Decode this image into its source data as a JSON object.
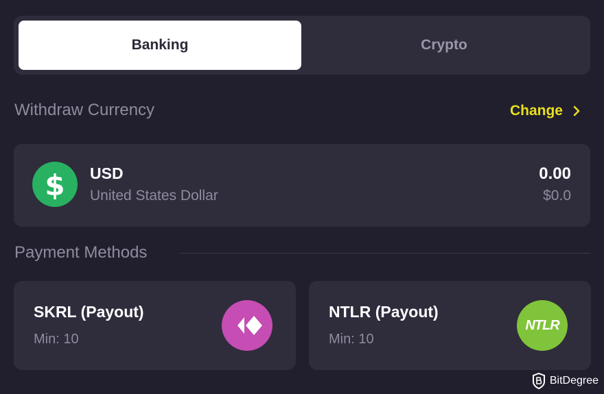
{
  "tabs": [
    {
      "label": "Banking",
      "active": true
    },
    {
      "label": "Crypto",
      "active": false
    }
  ],
  "withdraw_currency": {
    "title": "Withdraw Currency",
    "change_label": "Change",
    "currency": {
      "icon": "dollar-icon",
      "symbol": "$",
      "code": "USD",
      "name": "United States Dollar",
      "amount": "0.00",
      "usd_value": "$0.0"
    }
  },
  "payment_methods": {
    "title": "Payment Methods",
    "items": [
      {
        "name": "SKRL (Payout)",
        "min": "Min: 10",
        "logo": "skrl-logo",
        "logo_color": "#c54db3"
      },
      {
        "name": "NTLR (Payout)",
        "min": "Min: 10",
        "logo": "ntlr-logo",
        "logo_text": "NTLR",
        "logo_color": "#7fc43a"
      }
    ]
  },
  "watermark": {
    "text": "BitDegree"
  },
  "colors": {
    "background": "#211f2d",
    "card": "#2f2c3c",
    "accent": "#e8e021",
    "muted_text": "#8f8c9e",
    "success": "#27b160"
  }
}
